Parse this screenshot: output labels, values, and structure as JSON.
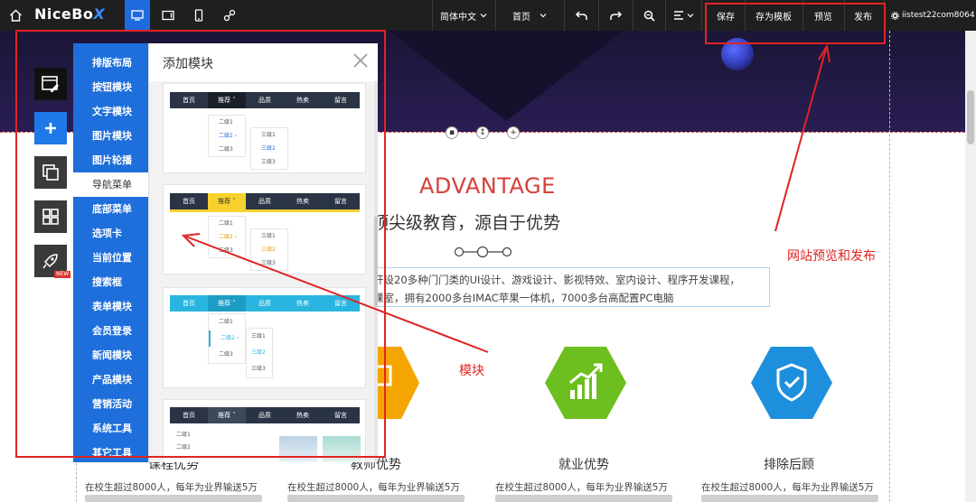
{
  "topbar": {
    "brand_main": "NiceBo",
    "brand_x": "X",
    "language": "简体中文",
    "page_select": "首页",
    "save": "保存",
    "save_template": "存为模板",
    "preview": "预览",
    "publish": "发布",
    "username": "iistest22com8064"
  },
  "colors": {
    "topbar_bg": "#1f1f1f",
    "accent_blue": "#1e6fdb",
    "annotation_red": "#e02424",
    "hex_yellow": "#f5a500",
    "hex_green": "#6cbf1e",
    "hex_blue": "#1e8fdc"
  },
  "module_panel": {
    "title": "添加模块",
    "categories": [
      "排版布局",
      "按钮模块",
      "文字模块",
      "图片模块",
      "图片轮播",
      "导航菜单",
      "底部菜单",
      "选项卡",
      "当前位置",
      "搜索框",
      "表单模块",
      "会员登录",
      "新闻模块",
      "产品模块",
      "营销活动",
      "系统工具",
      "其它工具"
    ],
    "nav_items": [
      "首页",
      "推荐",
      "品质",
      "热卖",
      "留言"
    ],
    "nav_items_alt": [
      "首页",
      "推荐",
      "品质",
      "热卖",
      "留言"
    ],
    "sub_level2": [
      "二级1",
      "二级2",
      "二级3"
    ],
    "sub_level3": [
      "三级1",
      "三级2",
      "三级3"
    ]
  },
  "left_toolbar": {
    "new_badge": "NEW"
  },
  "page": {
    "advantage": "ADVANTAGE",
    "subtitle": "顶尖级教育，源自于优势",
    "desc_line1": "开设20多种门门类的UI设计、游戏设计、影视特效、室内设计、程序开发课程，",
    "desc_line2": "课室，拥有2000多台IMAC苹果一体机，7000多台高配置PC电脑",
    "features": [
      {
        "label": "课程优势",
        "desc": "在校生超过8000人，每年为业界输送5万以"
      },
      {
        "label": "教师优势",
        "desc": "在校生超过8000人，每年为业界输送5万以"
      },
      {
        "label": "就业优势",
        "desc": "在校生超过8000人，每年为业界输送5万以"
      },
      {
        "label": "排除后顾",
        "desc": "在校生超过8000人，每年为业界输送5万以"
      }
    ]
  },
  "annotations": {
    "publish_label": "网站预览和发布",
    "module_label": "模块"
  }
}
